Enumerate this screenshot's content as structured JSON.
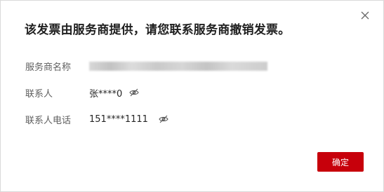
{
  "dialog": {
    "title": "该发票由服务商提供，请您联系服务商撤销发票。",
    "close_icon": "close-icon"
  },
  "fields": {
    "provider": {
      "label": "服务商名称",
      "value": ""
    },
    "contact": {
      "label": "联系人",
      "value": "张****0",
      "toggle_icon": "eye-hidden-icon"
    },
    "phone": {
      "label": "联系人电话",
      "value": "151****1111",
      "toggle_icon": "eye-hidden-icon"
    }
  },
  "actions": {
    "confirm_label": "确定"
  },
  "colors": {
    "primary": "#c7000b",
    "label": "#5f5f5f",
    "text": "#252525"
  }
}
